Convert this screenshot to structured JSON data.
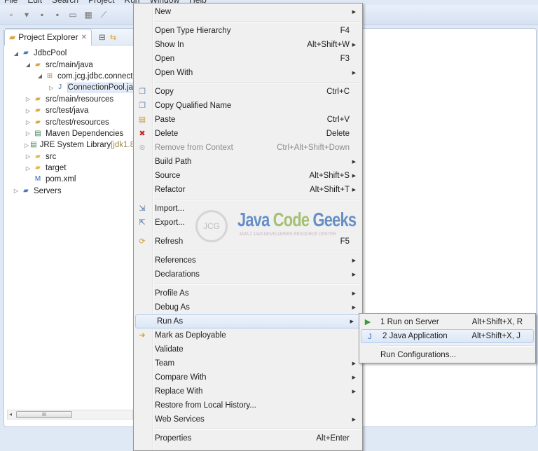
{
  "menubar": [
    "File",
    "Edit",
    "Search",
    "Project",
    "Run",
    "Window",
    "Help"
  ],
  "explorer": {
    "title": "Project Explorer",
    "tree": [
      {
        "label": "JdbcPool",
        "depth": 0,
        "tw": "open",
        "icon": "project-icon",
        "color": "#4a7ab8"
      },
      {
        "label": "src/main/java",
        "depth": 1,
        "tw": "open",
        "icon": "source-folder-icon",
        "color": "#d9a642"
      },
      {
        "label": "com.jcg.jdbc.connect",
        "depth": 2,
        "tw": "open",
        "icon": "package-icon",
        "color": "#c8822e"
      },
      {
        "label": "ConnectionPool.ja",
        "depth": 3,
        "tw": "closed",
        "icon": "java-file-icon",
        "color": "#4a6fa0",
        "selected": true
      },
      {
        "label": "src/main/resources",
        "depth": 1,
        "tw": "closed",
        "icon": "source-folder-icon",
        "color": "#d9a642"
      },
      {
        "label": "src/test/java",
        "depth": 1,
        "tw": "closed",
        "icon": "source-folder-icon",
        "color": "#d9a642"
      },
      {
        "label": "src/test/resources",
        "depth": 1,
        "tw": "closed",
        "icon": "source-folder-icon",
        "color": "#d9a642"
      },
      {
        "label": "Maven Dependencies",
        "depth": 1,
        "tw": "closed",
        "icon": "library-icon",
        "color": "#3c7a4a"
      },
      {
        "label": "JRE System Library",
        "suffix": " [jdk1.8",
        "depth": 1,
        "tw": "closed",
        "icon": "library-icon",
        "color": "#3c7a4a"
      },
      {
        "label": "src",
        "depth": 1,
        "tw": "closed",
        "icon": "folder-icon",
        "color": "#e2b64c"
      },
      {
        "label": "target",
        "depth": 1,
        "tw": "closed",
        "icon": "folder-icon",
        "color": "#e2b64c"
      },
      {
        "label": "pom.xml",
        "depth": 1,
        "tw": "none",
        "icon": "maven-file-icon",
        "color": "#3060b0"
      },
      {
        "label": "Servers",
        "depth": 0,
        "tw": "closed",
        "icon": "folder-icon",
        "color": "#4a7ab8"
      }
    ]
  },
  "context_menu": [
    [
      {
        "label": "New",
        "submenu": true
      }
    ],
    [
      {
        "label": "Open Type Hierarchy",
        "shortcut": "F4"
      },
      {
        "label": "Show In",
        "shortcut": "Alt+Shift+W",
        "submenu": true
      },
      {
        "label": "Open",
        "shortcut": "F3"
      },
      {
        "label": "Open With",
        "submenu": true
      }
    ],
    [
      {
        "label": "Copy",
        "shortcut": "Ctrl+C",
        "icon": "copy-icon"
      },
      {
        "label": "Copy Qualified Name",
        "icon": "copy-qualified-icon"
      },
      {
        "label": "Paste",
        "shortcut": "Ctrl+V",
        "icon": "paste-icon"
      },
      {
        "label": "Delete",
        "shortcut": "Delete",
        "icon": "delete-icon"
      },
      {
        "label": "Remove from Context",
        "shortcut": "Ctrl+Alt+Shift+Down",
        "icon": "remove-context-icon",
        "disabled": true
      },
      {
        "label": "Build Path",
        "submenu": true
      },
      {
        "label": "Source",
        "shortcut": "Alt+Shift+S",
        "submenu": true
      },
      {
        "label": "Refactor",
        "shortcut": "Alt+Shift+T",
        "submenu": true
      }
    ],
    [
      {
        "label": "Import...",
        "icon": "import-icon"
      },
      {
        "label": "Export...",
        "icon": "export-icon"
      }
    ],
    [
      {
        "label": "Refresh",
        "shortcut": "F5",
        "icon": "refresh-icon"
      }
    ],
    [
      {
        "label": "References",
        "submenu": true
      },
      {
        "label": "Declarations",
        "submenu": true
      }
    ],
    [
      {
        "label": "Profile As",
        "submenu": true
      },
      {
        "label": "Debug As",
        "submenu": true
      },
      {
        "label": "Run As",
        "submenu": true,
        "highlighted": true
      },
      {
        "label": "Mark as Deployable",
        "icon": "deploy-icon"
      },
      {
        "label": "Validate"
      },
      {
        "label": "Team",
        "submenu": true
      },
      {
        "label": "Compare With",
        "submenu": true
      },
      {
        "label": "Replace With",
        "submenu": true
      },
      {
        "label": "Restore from Local History..."
      },
      {
        "label": "Web Services",
        "submenu": true
      }
    ],
    [
      {
        "label": "Properties",
        "shortcut": "Alt+Enter"
      }
    ]
  ],
  "run_as_submenu": [
    [
      {
        "label": "1 Run on Server",
        "shortcut": "Alt+Shift+X, R",
        "icon": "run-server-icon"
      },
      {
        "label": "2 Java Application",
        "shortcut": "Alt+Shift+X, J",
        "icon": "java-app-icon",
        "highlighted": true
      }
    ],
    [
      {
        "label": "Run Configurations..."
      }
    ]
  ],
  "watermark": {
    "title_a": "Java ",
    "title_b": "Code ",
    "title_c": "Geeks",
    "subtitle": "JAVA 2 JAVA DEVELOPERS RESOURCE CENTER",
    "badge": "JCG"
  },
  "colors": {
    "highlight": "#dce7f6",
    "delete": "#d42020",
    "wm_blue": "#3a6fb8",
    "wm_green": "#8bb04a"
  }
}
